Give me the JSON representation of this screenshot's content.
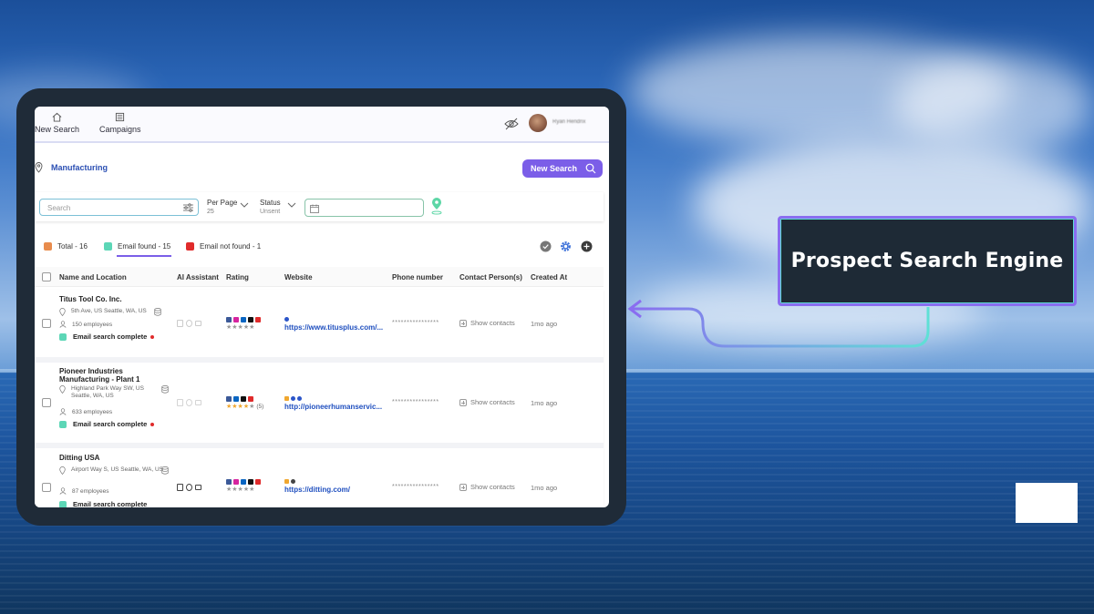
{
  "nav": {
    "new_search": "New Search",
    "campaigns": "Campaigns",
    "user_name": "Ryan Hendrix"
  },
  "location": {
    "label": "Manufacturing",
    "new_search_button": "New Search"
  },
  "filters": {
    "search_placeholder": "Search",
    "per_page_label": "Per Page",
    "per_page_value": "25",
    "status_label": "Status",
    "status_value": "Unsent"
  },
  "summary": {
    "total": "Total - 16",
    "email_found": "Email found - 15",
    "email_not_found": "Email not found - 1",
    "colors": {
      "total": "#e88c4d",
      "found": "#5cd6b6",
      "not_found": "#e02b2b"
    }
  },
  "table": {
    "columns": [
      "Name and Location",
      "AI Assistant",
      "Rating",
      "Website",
      "Phone number",
      "Contact Person(s)",
      "Created At"
    ],
    "rows": [
      {
        "name": "Titus Tool Co. Inc.",
        "address": "5th Ave, US Seattle, WA, US",
        "employees": "150 employees",
        "email_status": "Email search complete",
        "rating_count": "",
        "website": "https://www.titusplus.com/...",
        "phone": "****************",
        "contacts": "Show contacts",
        "created": "1mo ago"
      },
      {
        "name": "Pioneer Industries Manufacturing - Plant 1",
        "address": "Highland Park Way SW, US Seattle, WA, US",
        "employees": "633 employees",
        "email_status": "Email search complete",
        "rating_count": "(5)",
        "website": "http://pioneerhumanservic...",
        "phone": "****************",
        "contacts": "Show contacts",
        "created": "1mo ago"
      },
      {
        "name": "Ditting USA",
        "address": "Airport Way S, US Seattle, WA, US",
        "employees": "87 employees",
        "email_status": "Email search complete",
        "rating_count": "",
        "website": "https://ditting.com/",
        "phone": "****************",
        "contacts": "Show contacts",
        "created": "1mo ago"
      }
    ]
  },
  "callout": {
    "title": "Prospect Search Engine"
  },
  "accent_color": "#7b5ee8"
}
